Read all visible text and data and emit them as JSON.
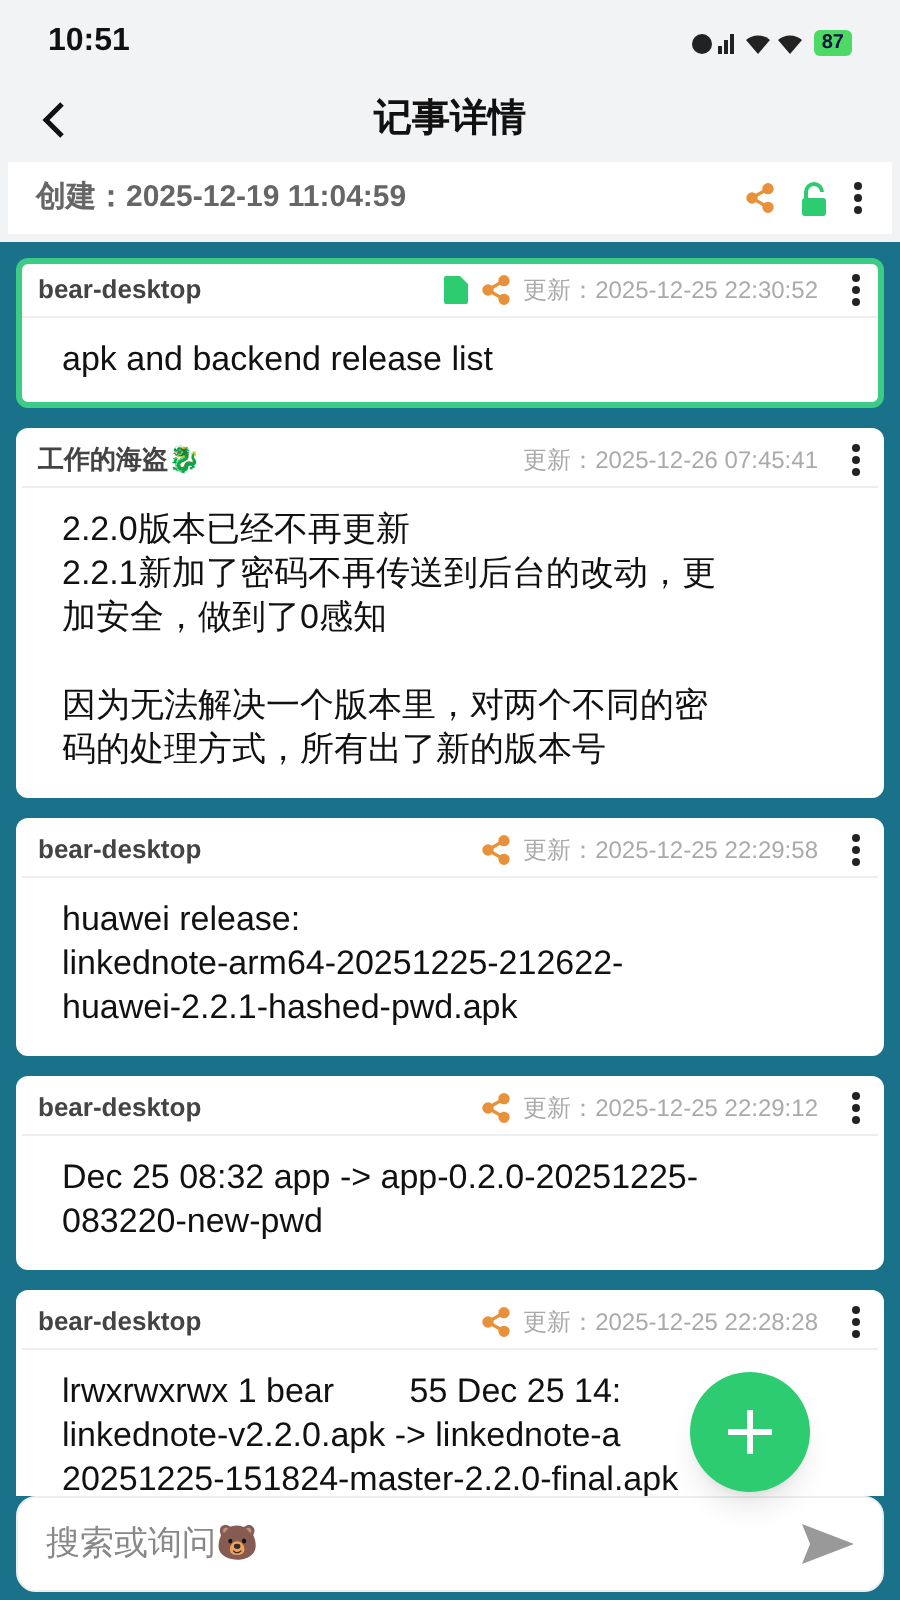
{
  "status_bar": {
    "time": "10:51",
    "battery": "87"
  },
  "header": {
    "title": "记事详情"
  },
  "created": {
    "label": "创建：2025-12-19 11:04:59",
    "locked": false
  },
  "notes": [
    {
      "author": "bear-desktop",
      "selected": true,
      "has_file": true,
      "shared": true,
      "updated": "更新：2025-12-25 22:30:52",
      "paragraphs": [
        [
          "apk and backend release list"
        ]
      ]
    },
    {
      "author": "工作的海盗🐉",
      "selected": false,
      "has_file": false,
      "shared": false,
      "updated": "更新：2025-12-26 07:45:41",
      "paragraphs": [
        [
          "2.2.0版本已经不再更新",
          "2.2.1新加了密码不再传送到后台的改动，更",
          "加安全，做到了0感知"
        ],
        [
          "因为无法解决一个版本里，对两个不同的密",
          "码的处理方式，所有出了新的版本号"
        ]
      ]
    },
    {
      "author": "bear-desktop",
      "selected": false,
      "has_file": false,
      "shared": true,
      "updated": "更新：2025-12-25 22:29:58",
      "paragraphs": [
        [
          "huawei release:",
          "linkednote-arm64-20251225-212622-",
          "huawei-2.2.1-hashed-pwd.apk"
        ]
      ]
    },
    {
      "author": "bear-desktop",
      "selected": false,
      "has_file": false,
      "shared": true,
      "updated": "更新：2025-12-25 22:29:12",
      "paragraphs": [
        [
          "Dec 25 08:32 app -> app-0.2.0-20251225-",
          "083220-new-pwd"
        ]
      ]
    },
    {
      "author": "bear-desktop",
      "selected": false,
      "has_file": false,
      "shared": true,
      "updated": "更新：2025-12-25 22:28:28",
      "paragraphs": [
        [
          "lrwxrwxrwx 1 bear        55 Dec 25 14:",
          "linkednote-v2.2.0.apk -> linkednote-a",
          "20251225-151824-master-2.2.0-final.apk"
        ]
      ]
    }
  ],
  "search": {
    "placeholder": "搜索或询问🐻"
  }
}
